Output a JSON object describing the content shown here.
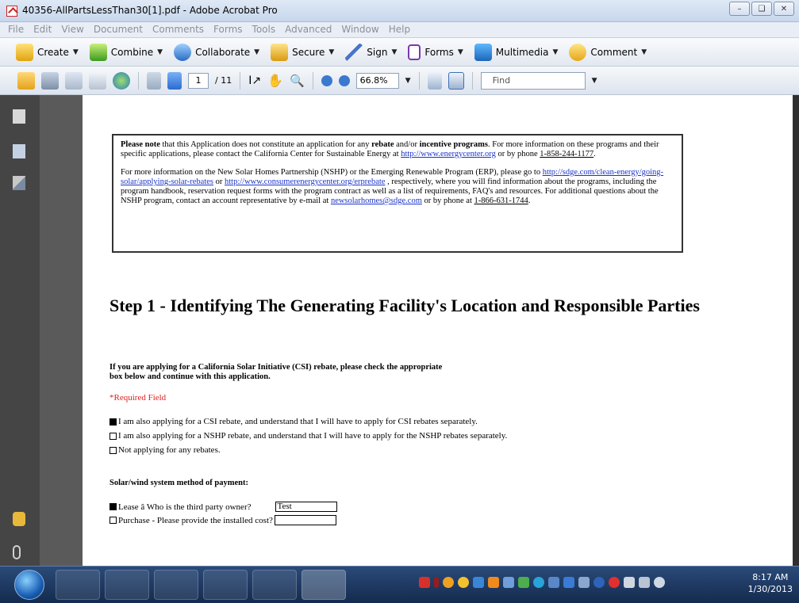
{
  "window": {
    "title": "40356-AllPartsLessThan30[1].pdf - Adobe Acrobat Pro"
  },
  "menu": [
    "File",
    "Edit",
    "View",
    "Document",
    "Comments",
    "Forms",
    "Tools",
    "Advanced",
    "Window",
    "Help"
  ],
  "tasks": {
    "create": "Create",
    "combine": "Combine",
    "collaborate": "Collaborate",
    "secure": "Secure",
    "sign": "Sign",
    "forms": "Forms",
    "multimedia": "Multimedia",
    "comment": "Comment"
  },
  "nav": {
    "page_current": "1",
    "page_total": "/ 11",
    "zoom": "66.8%",
    "find_placeholder": "Find"
  },
  "document": {
    "note": {
      "p1_b1": "Please note",
      "p1_t1": " that this Application does not constitute an application for any ",
      "p1_b2": "rebate",
      "p1_t2": " and/or ",
      "p1_b3": "incentive programs",
      "p1_t3": ". For more information on these programs and their specific applications, please contact the California Center for Sustainable Energy at ",
      "p1_link": "http://www.energycenter.org",
      "p1_t4": " or by phone ",
      "p1_phone": "1-858-244-1177",
      "p1_t5": ".",
      "p2_t1": "For more information on the New Solar Homes Partnership (NSHP) or the Emerging Renewable Program (ERP), please go to ",
      "p2_link1": "http://sdge.com/clean-energy/going-solar/applying-solar-rebates",
      "p2_t2": " or ",
      "p2_link2": "http://www.consumerenergycenter.org/erprebate",
      "p2_t3": " , respectively, where you will find information about the programs, including the program handbook, reservation request forms with the program contract as well as a list of requirements, FAQ's and resources. For additional questions about the NSHP program, contact an account representative by e-mail at ",
      "p2_email": "newsolarhomes@sdge.com",
      "p2_t4": " or by phone at ",
      "p2_phone": "1-866-631-1744",
      "p2_t5": "."
    },
    "heading": "Step 1 - Identifying The Generating Facility's Location and Responsible Parties",
    "csi_question": "If you are applying for a California Solar Initiative (CSI) rebate, please check the appropriate box below and continue with this application.",
    "required": "*Required Field",
    "options": [
      "I am also applying for a CSI rebate, and understand that I will have to apply for CSI rebates separately.",
      "I am also applying for a NSHP rebate, and understand that I will have to apply for the NSHP rebates separately.",
      "Not applying for any rebates."
    ],
    "payment_heading": "Solar/wind system method of payment:",
    "lease_label": "Lease â Who is the third party owner?",
    "lease_value": "Test",
    "purchase_label": "Purchase - Please provide the installed cost?",
    "purchase_value": ""
  },
  "taskbar": {
    "time": "8:17 AM",
    "date": "1/30/2013"
  },
  "colors": {
    "link": "#1a34c8",
    "required": "#e02020"
  }
}
